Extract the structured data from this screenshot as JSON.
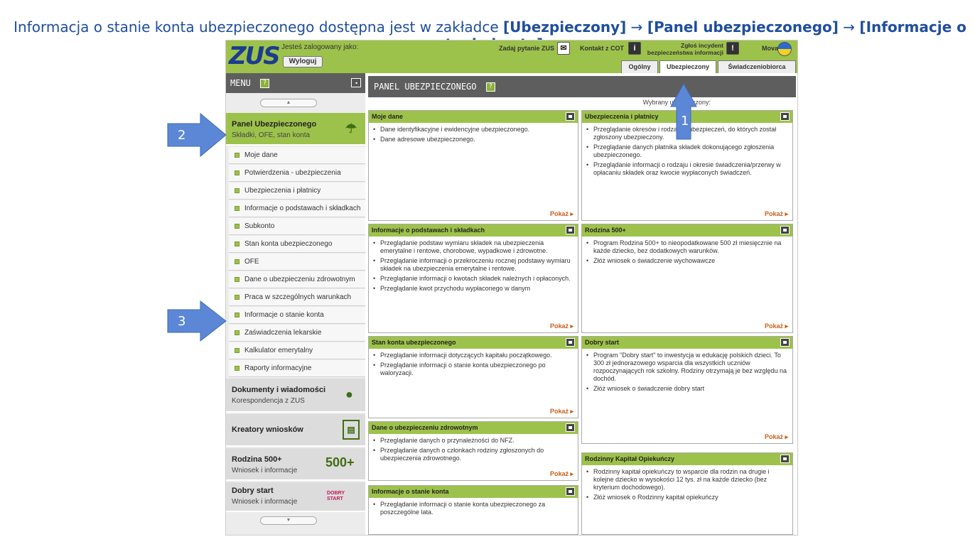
{
  "heading": {
    "lead": "Informacja o stanie konta ubezpieczonego dostępna jest w zakładce ",
    "step1": "[Ubezpieczony]",
    "arrow1": " → ",
    "step2": "[Panel ubezpieczonego]",
    "arrow2": " → ",
    "step3": "[Informacje o stanie konta]"
  },
  "topbar": {
    "logo": "ZUS",
    "logged_as": "Jesteś zalogowany jako:",
    "logout": "Wyloguj",
    "ask": "Zadaj pytanie ZUS",
    "contact": "Kontakt z COT",
    "incident": "Zgłoś incydent bezpieczeństwa informacji",
    "lang": "Mova",
    "tabs": [
      "Ogólny",
      "Ubezpieczony",
      "Świadczeniobiorca"
    ]
  },
  "sidebar": {
    "menu_label": "MENU",
    "help": "?",
    "panel": {
      "title": "Panel Ubezpieczonego",
      "subtitle": "Składki, OFE, stan konta"
    },
    "items": [
      "Moje dane",
      "Potwierdzenia - ubezpieczenia",
      "Ubezpieczenia i płatnicy",
      "Informacje o podstawach i składkach",
      "Subkonto",
      "Stan konta ubezpieczonego",
      "OFE",
      "Dane o ubezpieczeniu zdrowotnym",
      "Praca w szczególnych warunkach",
      "Informacje o stanie konta",
      "Zaświadczenia lekarskie",
      "Kalkulator emerytalny",
      "Raporty informacyjne"
    ],
    "docs": {
      "title": "Dokumenty i wiadomości",
      "subtitle": "Korespondencja z ZUS"
    },
    "creators": {
      "title": "Kreatory wniosków"
    },
    "family": {
      "title": "Rodzina 500+",
      "subtitle": "Wniosek i informacje",
      "badge": "500+"
    },
    "goodstart": {
      "title": "Dobry start",
      "subtitle": "Wniosek i informacje",
      "badge": "DOBRY START"
    }
  },
  "main": {
    "title": "PANEL UBEZPIECZONEGO",
    "help": "?",
    "selected_label": "Wybrany ubezpieczony:",
    "show_label": "Pokaż ▸",
    "cards": {
      "moje_dane": {
        "title": "Moje dane",
        "items": [
          "Dane identyfikacyjne i ewidencyjne ubezpieczonego.",
          "Dane adresowe ubezpieczonego."
        ]
      },
      "ubezp": {
        "title": "Ubezpieczenia i płatnicy",
        "items": [
          "Przeglądanie okresów i rodzajów ubezpieczeń, do których został zgłoszony ubezpieczony.",
          "Przeglądanie danych płatnika składek dokonującego zgłoszenia ubezpieczonego.",
          "Przeglądanie informacji o rodzaju i okresie świadczenia/przerwy w opłacaniu składek oraz kwocie wypłaconych świadczeń."
        ]
      },
      "podstawy": {
        "title": "Informacje o podstawach i składkach",
        "items": [
          "Przeglądanie podstaw wymiaru składek na ubezpieczenia emerytalne i rentowe, chorobowe, wypadkowe i zdrowotne.",
          "Przeglądanie informacji o przekroczeniu rocznej podstawy wymiaru składek na ubezpieczenia emerytalne i rentowe.",
          "Przeglądanie informacji o kwotach składek należnych i opłaconych.",
          "Przeglądanie kwot przychodu wypłaconego w danym"
        ]
      },
      "rodzina": {
        "title": "Rodzina 500+",
        "items": [
          "Program Rodzina 500+ to nieopodatkowane 500 zł miesięcznie na każde dziecko, bez dodatkowych warunków.",
          "Złóż wniosek o świadczenie wychowawcze"
        ]
      },
      "stan": {
        "title": "Stan konta ubezpieczonego",
        "items": [
          "Przeglądanie informacji dotyczących kapitału początkowego.",
          "Przeglądanie informacji o stanie konta ubezpieczonego po waloryzacji."
        ]
      },
      "dobry": {
        "title": "Dobry start",
        "items": [
          "Program \"Dobry start\" to inwestycja w edukację polskich dzieci. To 300 zł jednorazowego wsparcia dla wszystkich uczniów rozpoczynających rok szkolny. Rodziny otrzymają je bez względu na dochód.",
          "Złóż wniosek o świadczenie dobry start"
        ]
      },
      "zdrowie": {
        "title": "Dane o ubezpieczeniu zdrowotnym",
        "items": [
          "Przeglądanie danych o przynależności do NFZ.",
          "Przeglądanie danych o członkach rodziny zgłoszonych do ubezpieczenia zdrowotnego."
        ]
      },
      "kapital": {
        "title": "Rodzinny Kapitał Opiekuńczy",
        "items": [
          "Rodzinny kapitał opiekuńczy to wsparcie dla rodzin na drugie i kolejne dziecko w wysokości 12 tys. zł na każde dziecko (bez kryterium dochodowego).",
          "Złóż wniosek o Rodzinny kapitał opiekuńczy"
        ]
      },
      "stan_konta": {
        "title": "Informacje o stanie konta",
        "items": [
          "Przeglądanie informacji o stanie konta ubezpieczonego za poszczególne lata."
        ]
      }
    }
  },
  "annotations": {
    "n1": "1",
    "n2": "2",
    "n3": "3"
  },
  "colors": {
    "accent": "#9dc24b",
    "header": "#5e5e5e",
    "arrow": "#5b87d6",
    "heading": "#1f4e9c"
  }
}
